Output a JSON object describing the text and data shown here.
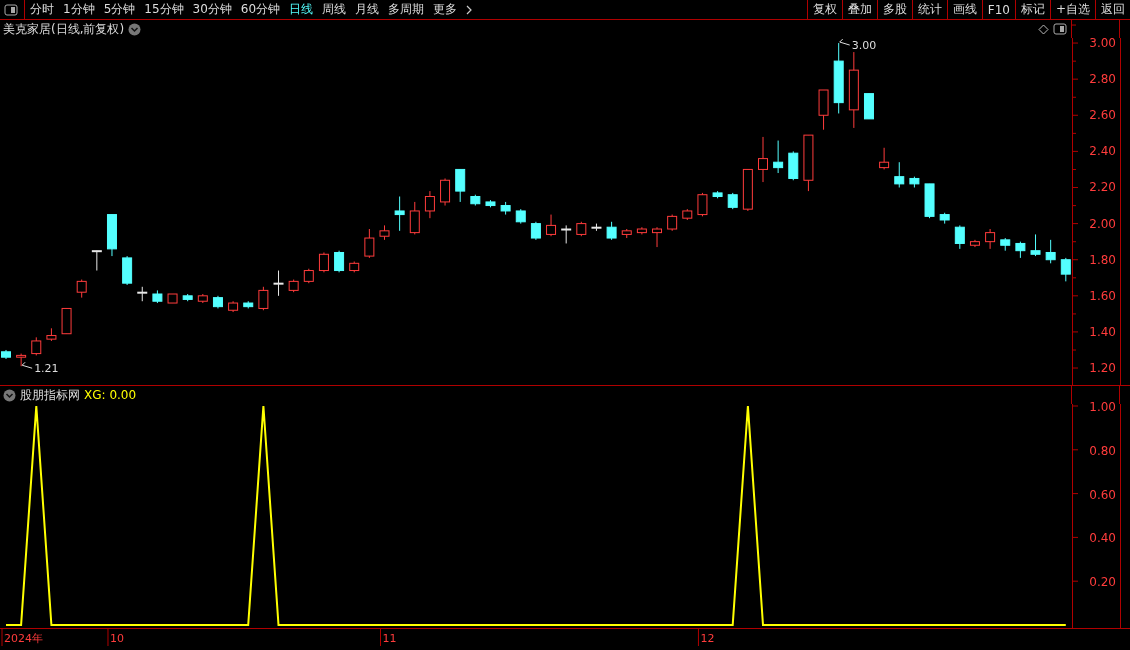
{
  "toolbar": {
    "tabs": [
      {
        "label": "分时",
        "selected": false
      },
      {
        "label": "1分钟",
        "selected": false
      },
      {
        "label": "5分钟",
        "selected": false
      },
      {
        "label": "15分钟",
        "selected": false
      },
      {
        "label": "30分钟",
        "selected": false
      },
      {
        "label": "60分钟",
        "selected": false
      },
      {
        "label": "日线",
        "selected": true
      },
      {
        "label": "周线",
        "selected": false
      },
      {
        "label": "月线",
        "selected": false
      },
      {
        "label": "多周期",
        "selected": false
      }
    ],
    "more": "更多",
    "buttons": [
      "复权",
      "叠加",
      "多股",
      "统计",
      "画线",
      "F10",
      "标记",
      "+自选",
      "返回"
    ]
  },
  "price_panel": {
    "title": "美克家居(日线,前复权)",
    "chart_data": {
      "type": "candlestick",
      "ylim": [
        1.106,
        3.028
      ],
      "yticks": [
        {
          "value": 1.2,
          "label": "1.20"
        },
        {
          "value": 1.4,
          "label": "1.40"
        },
        {
          "value": 1.6,
          "label": "1.60"
        },
        {
          "value": 1.8,
          "label": "1.80"
        },
        {
          "value": 2.0,
          "label": "2.00"
        },
        {
          "value": 2.2,
          "label": "2.20"
        },
        {
          "value": 2.4,
          "label": "2.40"
        },
        {
          "value": 2.6,
          "label": "2.60"
        },
        {
          "value": 2.8,
          "label": "2.80"
        },
        {
          "value": 3.0,
          "label": "3.00"
        }
      ],
      "ohlc": [
        [
          1.29,
          1.3,
          1.25,
          1.26
        ],
        [
          1.26,
          1.28,
          1.21,
          1.27
        ],
        [
          1.28,
          1.37,
          1.27,
          1.35
        ],
        [
          1.36,
          1.42,
          1.35,
          1.38
        ],
        [
          1.39,
          1.53,
          1.39,
          1.53
        ],
        [
          1.62,
          1.69,
          1.59,
          1.68
        ],
        [
          1.85,
          1.85,
          1.74,
          1.85
        ],
        [
          2.05,
          2.05,
          1.82,
          1.86
        ],
        [
          1.81,
          1.82,
          1.66,
          1.67
        ],
        [
          1.62,
          1.65,
          1.57,
          1.62
        ],
        [
          1.61,
          1.63,
          1.56,
          1.57
        ],
        [
          1.56,
          1.61,
          1.56,
          1.61
        ],
        [
          1.6,
          1.61,
          1.57,
          1.58
        ],
        [
          1.57,
          1.61,
          1.56,
          1.6
        ],
        [
          1.59,
          1.6,
          1.53,
          1.54
        ],
        [
          1.52,
          1.57,
          1.51,
          1.56
        ],
        [
          1.56,
          1.57,
          1.53,
          1.54
        ],
        [
          1.53,
          1.65,
          1.52,
          1.63
        ],
        [
          1.67,
          1.74,
          1.6,
          1.67
        ],
        [
          1.63,
          1.69,
          1.62,
          1.68
        ],
        [
          1.68,
          1.75,
          1.67,
          1.74
        ],
        [
          1.74,
          1.84,
          1.73,
          1.83
        ],
        [
          1.84,
          1.85,
          1.73,
          1.74
        ],
        [
          1.74,
          1.79,
          1.73,
          1.78
        ],
        [
          1.82,
          1.97,
          1.81,
          1.92
        ],
        [
          1.93,
          1.99,
          1.91,
          1.96
        ],
        [
          2.07,
          2.15,
          1.96,
          2.05
        ],
        [
          1.95,
          2.12,
          1.94,
          2.07
        ],
        [
          2.07,
          2.18,
          2.03,
          2.15
        ],
        [
          2.12,
          2.25,
          2.1,
          2.24
        ],
        [
          2.3,
          2.3,
          2.12,
          2.18
        ],
        [
          2.15,
          2.16,
          2.1,
          2.11
        ],
        [
          2.12,
          2.13,
          2.09,
          2.1
        ],
        [
          2.1,
          2.12,
          2.05,
          2.07
        ],
        [
          2.07,
          2.08,
          2.0,
          2.01
        ],
        [
          2.0,
          2.01,
          1.91,
          1.92
        ],
        [
          1.94,
          2.05,
          1.93,
          1.99
        ],
        [
          1.97,
          1.99,
          1.89,
          1.97
        ],
        [
          1.94,
          2.01,
          1.93,
          2.0
        ],
        [
          1.98,
          2.0,
          1.96,
          1.98
        ],
        [
          1.98,
          2.01,
          1.91,
          1.92
        ],
        [
          1.94,
          1.97,
          1.92,
          1.96
        ],
        [
          1.95,
          1.98,
          1.94,
          1.97
        ],
        [
          1.95,
          1.98,
          1.87,
          1.97
        ],
        [
          1.97,
          2.05,
          1.96,
          2.04
        ],
        [
          2.03,
          2.08,
          2.02,
          2.07
        ],
        [
          2.05,
          2.17,
          2.04,
          2.16
        ],
        [
          2.17,
          2.18,
          2.14,
          2.15
        ],
        [
          2.16,
          2.17,
          2.08,
          2.09
        ],
        [
          2.08,
          2.3,
          2.07,
          2.3
        ],
        [
          2.3,
          2.48,
          2.23,
          2.36
        ],
        [
          2.34,
          2.46,
          2.28,
          2.31
        ],
        [
          2.39,
          2.4,
          2.24,
          2.25
        ],
        [
          2.24,
          2.49,
          2.18,
          2.49
        ],
        [
          2.6,
          2.74,
          2.52,
          2.74
        ],
        [
          2.9,
          3.0,
          2.61,
          2.67
        ],
        [
          2.63,
          2.95,
          2.53,
          2.85
        ],
        [
          2.72,
          2.72,
          2.58,
          2.58
        ],
        [
          2.31,
          2.42,
          2.3,
          2.34
        ],
        [
          2.26,
          2.34,
          2.2,
          2.22
        ],
        [
          2.25,
          2.26,
          2.2,
          2.22
        ],
        [
          2.22,
          2.22,
          2.03,
          2.04
        ],
        [
          2.05,
          2.06,
          2.0,
          2.02
        ],
        [
          1.98,
          1.99,
          1.86,
          1.89
        ],
        [
          1.88,
          1.91,
          1.87,
          1.9
        ],
        [
          1.9,
          1.97,
          1.86,
          1.95
        ],
        [
          1.91,
          1.92,
          1.85,
          1.88
        ],
        [
          1.89,
          1.9,
          1.81,
          1.85
        ],
        [
          1.85,
          1.94,
          1.82,
          1.83
        ],
        [
          1.84,
          1.91,
          1.78,
          1.8
        ],
        [
          1.8,
          1.81,
          1.68,
          1.72
        ]
      ],
      "annotations": [
        "3.00",
        "1.21"
      ]
    }
  },
  "indicator_panel": {
    "title": "股朋指标网",
    "reading": "XG: 0.00",
    "chart_data": {
      "type": "line",
      "ylim": [
        -0.0137,
        1.0091
      ],
      "yticks": [
        {
          "value": 0.2,
          "label": "0.20"
        },
        {
          "value": 0.4,
          "label": "0.40"
        },
        {
          "value": 0.6,
          "label": "0.60"
        },
        {
          "value": 0.8,
          "label": "0.80"
        },
        {
          "value": 1.0,
          "label": "1.00"
        }
      ],
      "series": [
        {
          "color": "#ffff00",
          "values": [
            0,
            0,
            1,
            0,
            0,
            0,
            0,
            0,
            0,
            0,
            0,
            0,
            0,
            0,
            0,
            0,
            0,
            1,
            0,
            0,
            0,
            0,
            0,
            0,
            0,
            0,
            0,
            0,
            0,
            0,
            0,
            0,
            0,
            0,
            0,
            0,
            0,
            0,
            0,
            0,
            0,
            0,
            0,
            0,
            0,
            0,
            0,
            0,
            0,
            1,
            0,
            0,
            0,
            0,
            0,
            0,
            0,
            0,
            0,
            0,
            0,
            0,
            0,
            0,
            0,
            0,
            0,
            0,
            0,
            0,
            0
          ]
        }
      ]
    }
  },
  "date_axis": [
    "2024年",
    "10",
    "11",
    "12"
  ]
}
